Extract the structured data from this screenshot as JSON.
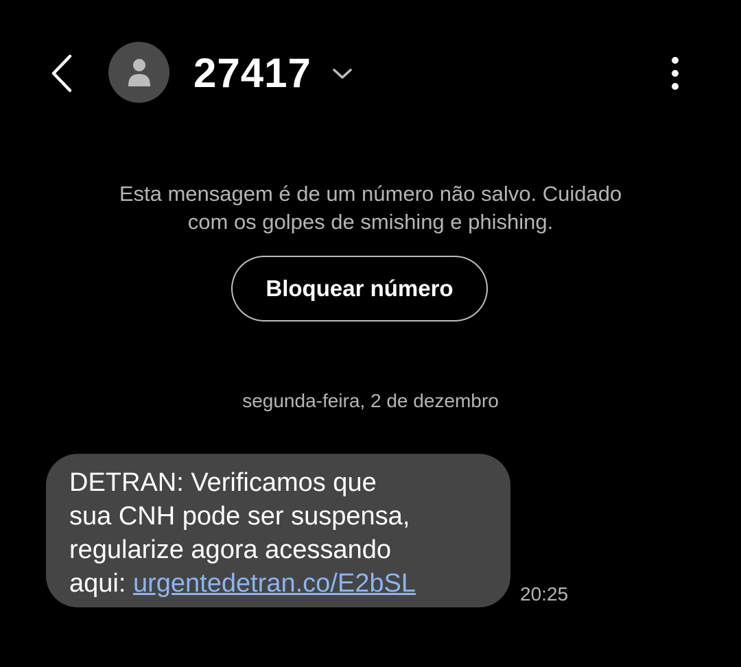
{
  "header": {
    "back_icon": "chevron-left-icon",
    "avatar_icon": "person-icon",
    "contact_name": "27417",
    "expand_icon": "chevron-down-icon",
    "more_icon": "more-vertical-icon"
  },
  "warning": {
    "line1": "Esta mensagem é de um número não salvo. Cuidado",
    "line2": "com os golpes de smishing e phishing.",
    "block_button_label": "Bloquear número"
  },
  "conversation": {
    "date_separator": "segunda-feira, 2 de dezembro",
    "messages": [
      {
        "line1": "DETRAN: Verificamos que",
        "line2": "sua CNH pode ser suspensa,",
        "line3": "regularize agora acessando",
        "line4_prefix": "aqui: ",
        "link_text": "urgentedetran.co/E2bSL",
        "time": "20:25"
      }
    ]
  },
  "colors": {
    "background": "#000000",
    "bubble": "#454545",
    "link": "#8db4f2",
    "secondary_text": "#b5b5b5"
  }
}
